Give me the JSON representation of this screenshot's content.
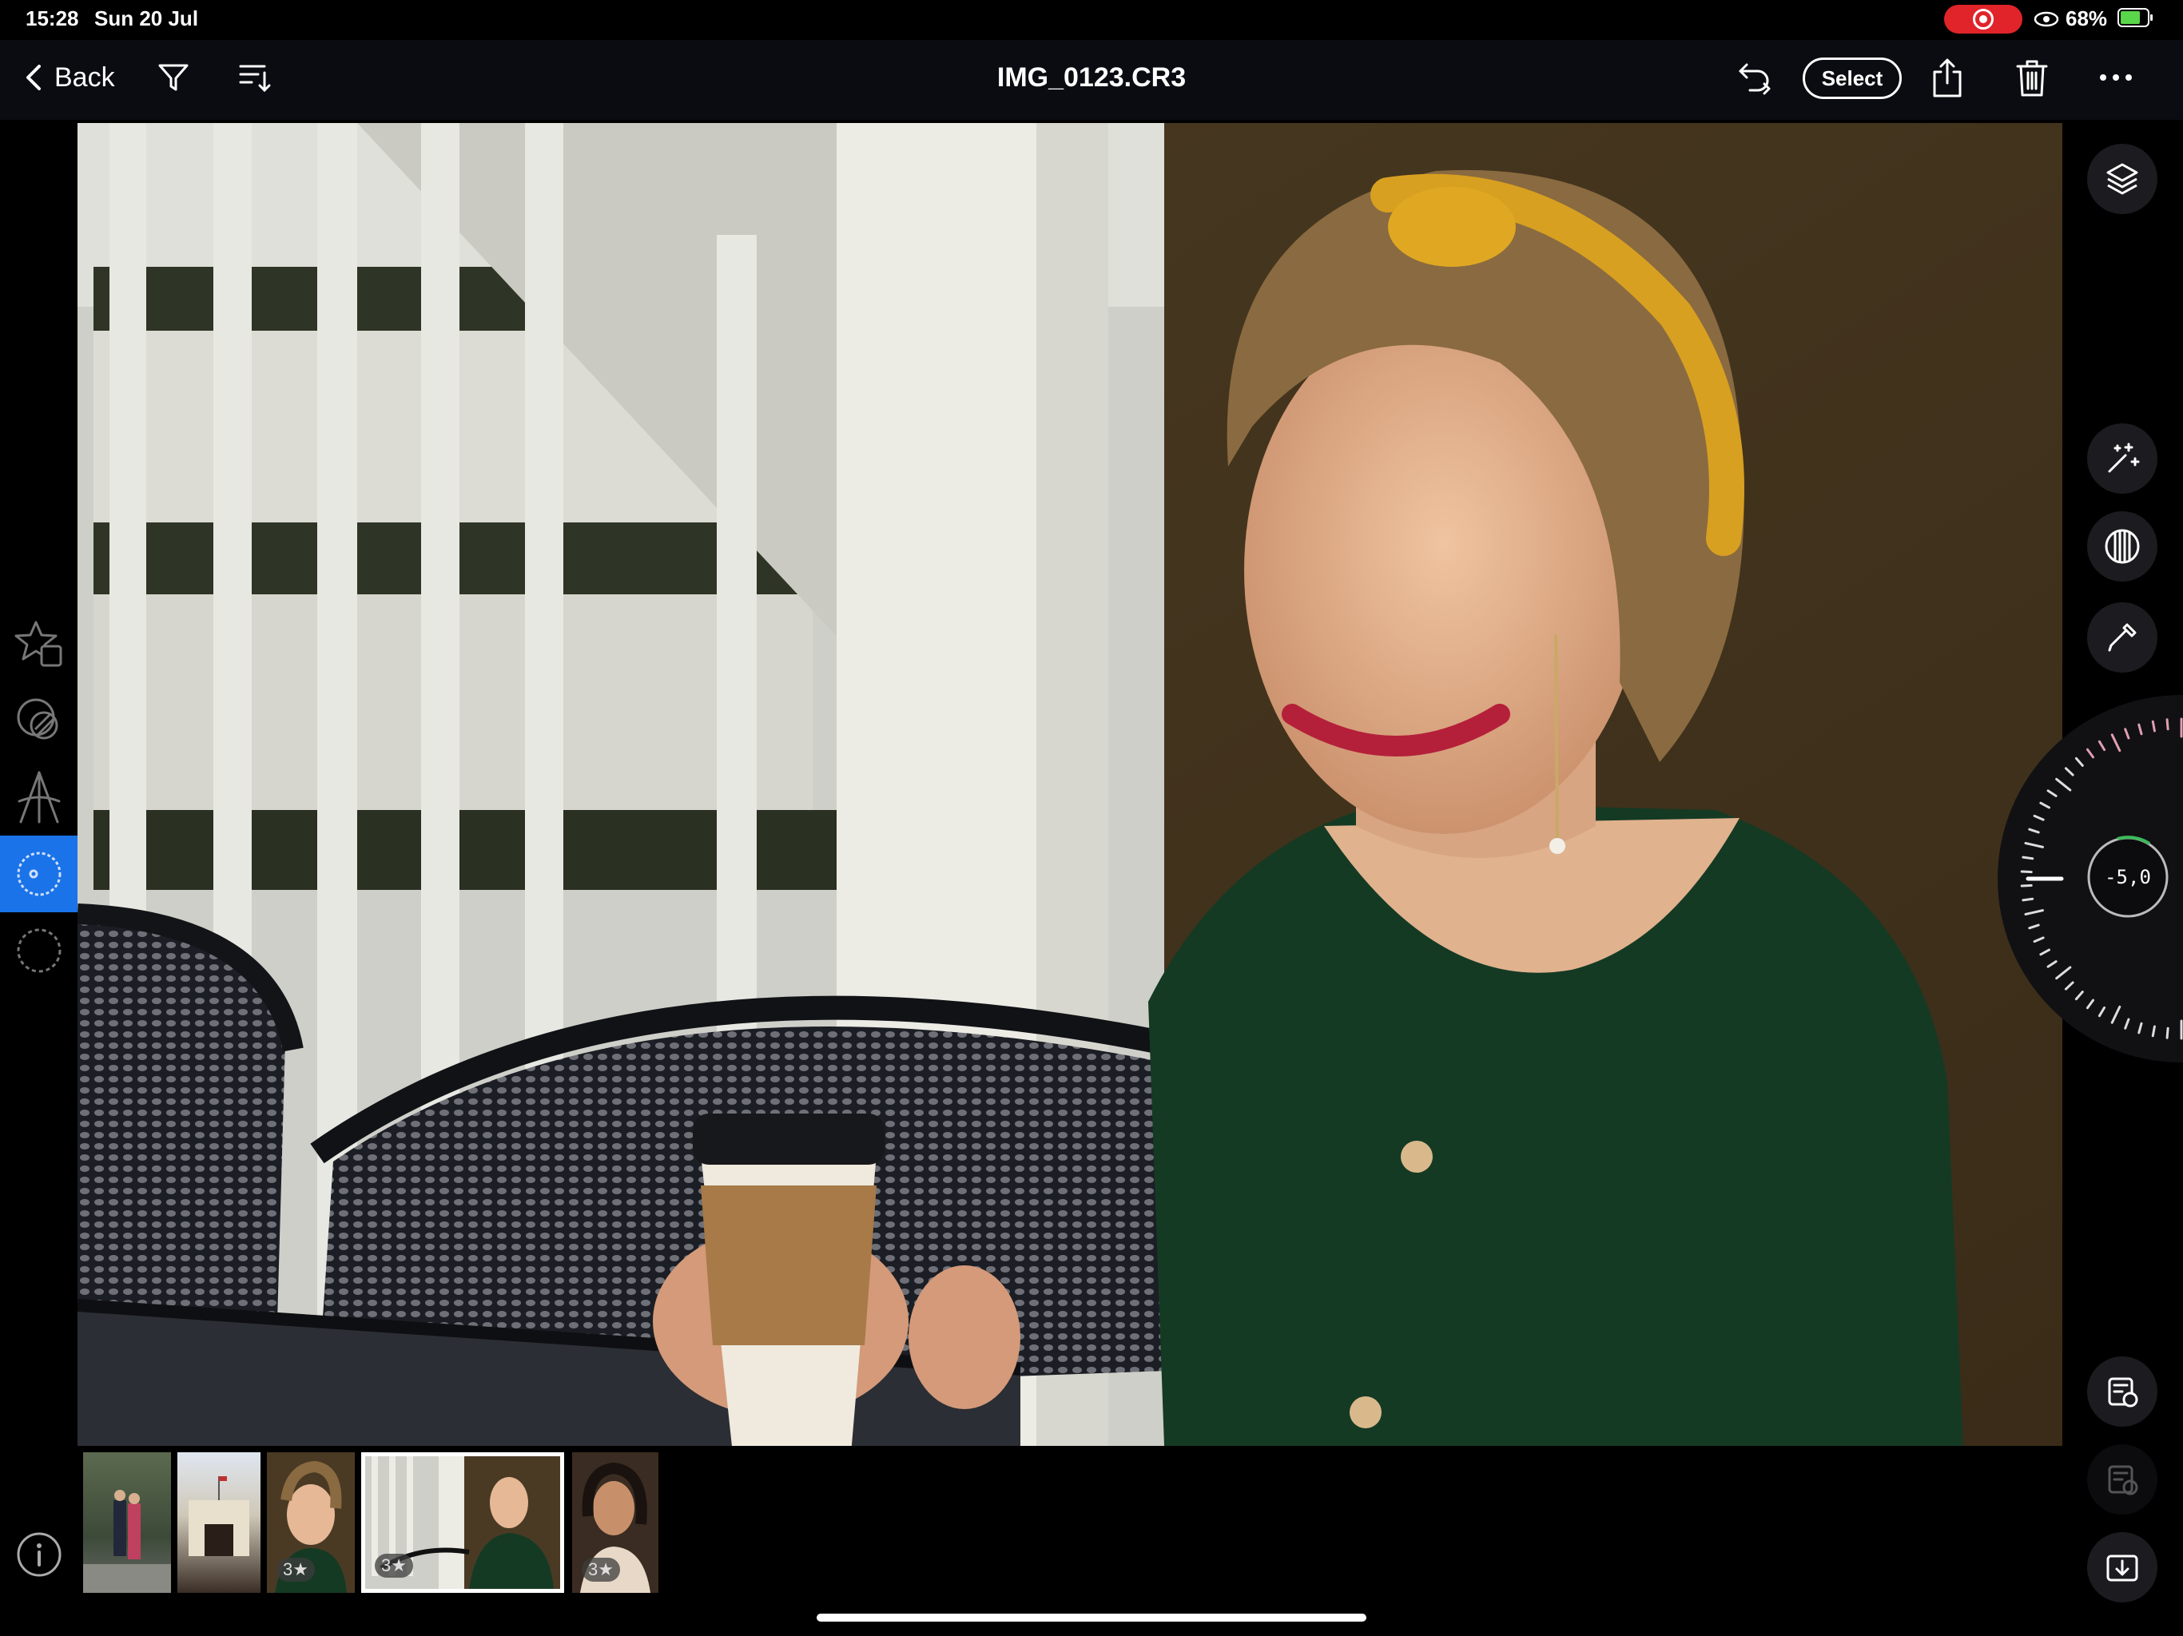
{
  "status_bar": {
    "time": "15:28",
    "date": "Sun 20 Jul",
    "battery": "68%",
    "battery_level": 0.68
  },
  "toolbar": {
    "back_label": "Back",
    "title": "IMG_0123.CR3",
    "select_label": "Select"
  },
  "adjust_dial": {
    "value": "-5,0"
  },
  "filmstrip": {
    "ratings": [
      "3★",
      "3★",
      "3★"
    ]
  },
  "colors": {
    "accent": "#1a73e8",
    "record": "#e0242a",
    "battery_fill": "#5ad64a"
  },
  "icons": {
    "left_tools": [
      "star-rating-icon",
      "color-mask-icon",
      "perspective-icon",
      "lens-icon",
      "selection-icon",
      "info-icon"
    ],
    "right_tools": [
      "layers-icon",
      "magic-wand-icon",
      "grain-icon",
      "eyedropper-icon",
      "copy-settings-icon",
      "paste-settings-icon",
      "export-icon"
    ],
    "toolbar": [
      "chevron-left-icon",
      "filter-icon",
      "sort-icon",
      "undo-icon",
      "share-icon",
      "trash-icon",
      "more-icon"
    ]
  }
}
